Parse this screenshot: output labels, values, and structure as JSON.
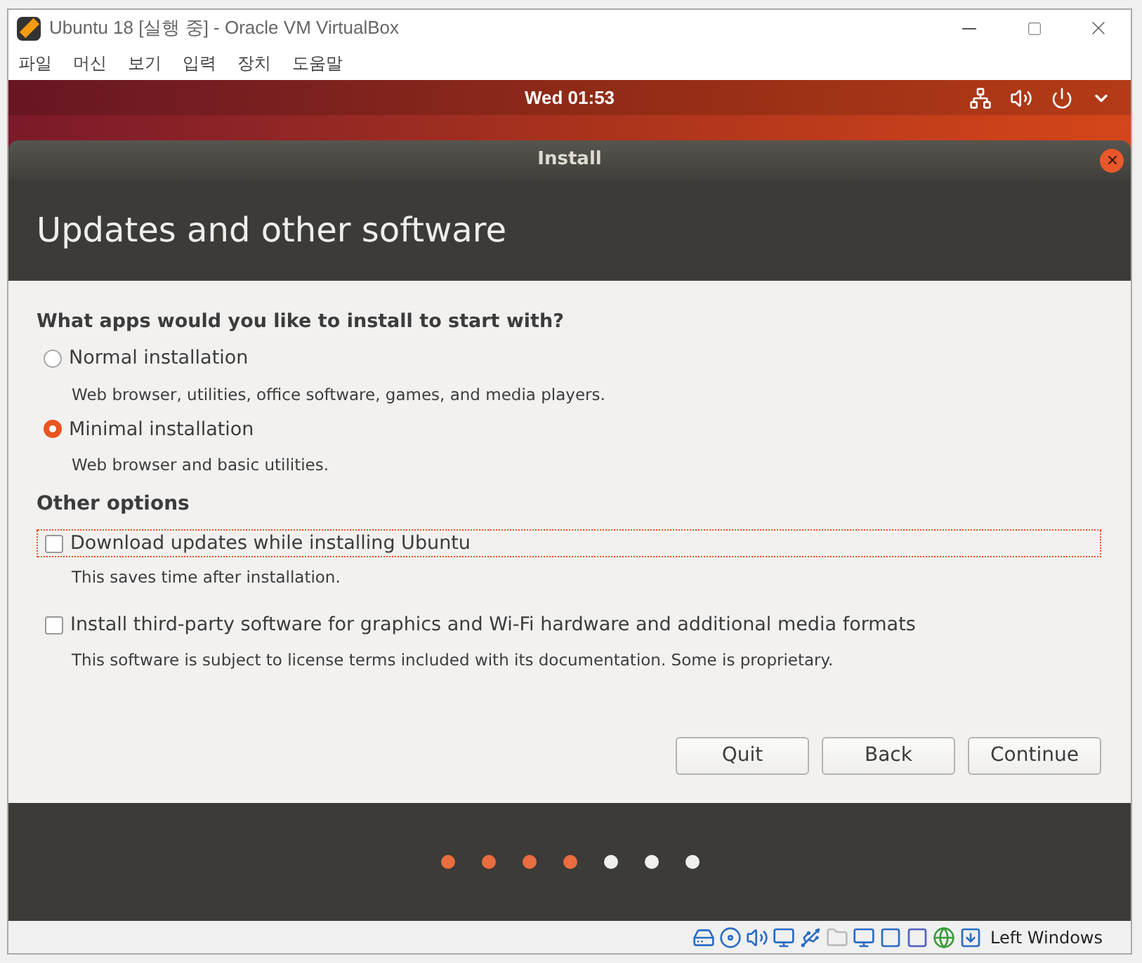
{
  "window": {
    "title": "Ubuntu 18 [실행 중] - Oracle VM VirtualBox"
  },
  "menu": [
    "파일",
    "머신",
    "보기",
    "입력",
    "장치",
    "도움말"
  ],
  "top_bar": {
    "clock": "Wed 01:53"
  },
  "dialog": {
    "title": "Install",
    "heading": "Updates and other software",
    "question": "What apps would you like to install to start with?",
    "install_types": [
      {
        "label": "Normal installation",
        "description": "Web browser, utilities, office software, games, and media players.",
        "selected": false
      },
      {
        "label": "Minimal installation",
        "description": "Web browser and basic utilities.",
        "selected": true
      }
    ],
    "other_heading": "Other options",
    "options": [
      {
        "label": "Download updates while installing Ubuntu",
        "description": "This saves time after installation.",
        "checked": false,
        "focused": true
      },
      {
        "label": "Install third-party software for graphics and Wi-Fi hardware and additional media formats",
        "description": "This software is subject to license terms included with its documentation. Some is proprietary.",
        "checked": false,
        "focused": false
      }
    ],
    "buttons": [
      "Quit",
      "Back",
      "Continue"
    ],
    "steps": [
      {
        "done": true
      },
      {
        "done": true
      },
      {
        "done": true
      },
      {
        "done": true
      },
      {
        "done": false
      },
      {
        "done": false
      },
      {
        "done": false
      }
    ]
  },
  "status_bar": {
    "host_key": "Left Windows"
  }
}
